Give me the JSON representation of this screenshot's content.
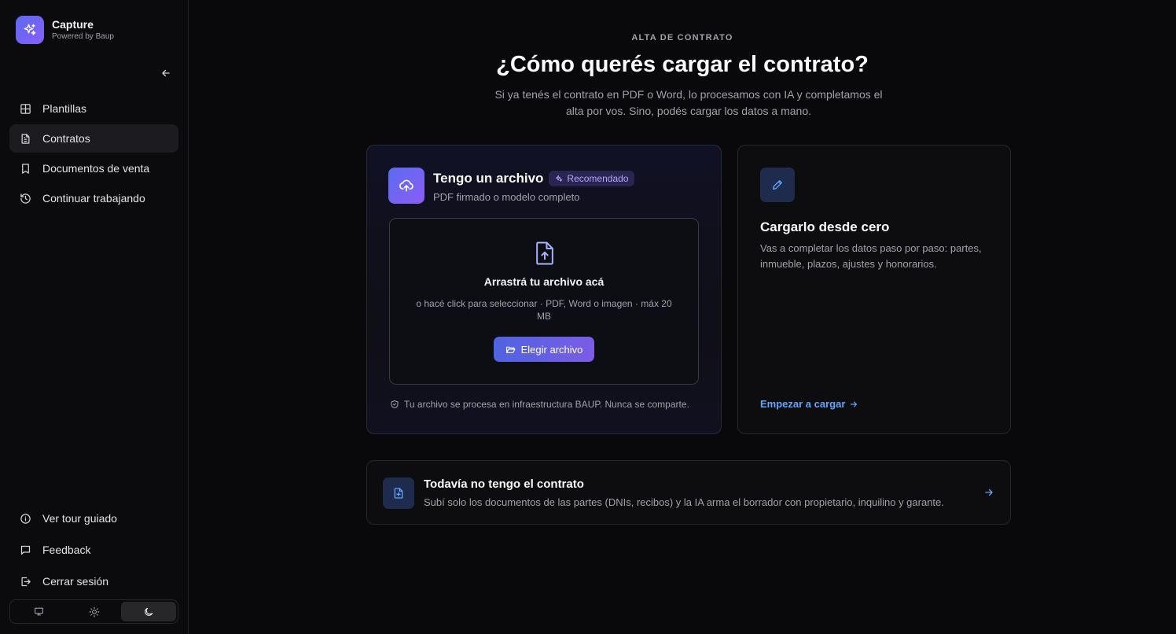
{
  "brand": {
    "name": "Capture",
    "tagline": "Powered by Baup"
  },
  "sidebar": {
    "items": [
      {
        "label": "Plantillas",
        "icon": "grid-icon",
        "active": false
      },
      {
        "label": "Contratos",
        "icon": "document-icon",
        "active": true
      },
      {
        "label": "Documentos de venta",
        "icon": "bookmark-icon",
        "active": false
      },
      {
        "label": "Continuar trabajando",
        "icon": "history-icon",
        "active": false
      }
    ],
    "bottom_items": [
      {
        "label": "Ver tour guiado",
        "icon": "info-icon"
      },
      {
        "label": "Feedback",
        "icon": "message-icon"
      },
      {
        "label": "Cerrar sesión",
        "icon": "logout-icon"
      }
    ],
    "theme_options": [
      "monitor-icon",
      "sun-icon",
      "moon-icon"
    ],
    "theme_active": "moon-icon"
  },
  "page": {
    "eyebrow": "ALTA DE CONTRATO",
    "title": "¿Cómo querés cargar el contrato?",
    "subtitle": "Si ya tenés el contrato en PDF o Word, lo procesamos con IA y completamos el alta por vos. Sino, podés cargar los datos a mano."
  },
  "upload_card": {
    "title": "Tengo un archivo",
    "badge": "Recomendado",
    "subtitle": "PDF firmado o modelo completo",
    "dropzone_title": "Arrastrá tu archivo acá",
    "dropzone_sub": "o hacé click para seleccionar · PDF, Word o imagen · máx 20 MB",
    "button": "Elegir archivo",
    "privacy": "Tu archivo se procesa en infraestructura BAUP. Nunca se comparte."
  },
  "manual_card": {
    "title": "Cargarlo desde cero",
    "description": "Vas a completar los datos paso por paso: partes, inmueble, plazos, ajustes y honorarios.",
    "link": "Empezar a cargar"
  },
  "no_contract_card": {
    "title": "Todavía no tengo el contrato",
    "description": "Subí solo los documentos de las partes (DNIs, recibos) y la IA arma el borrador con propietario, inquilino y garante."
  },
  "colors": {
    "accent_start": "#5b6cf0",
    "accent_end": "#8b5cf6",
    "link": "#60a5fa",
    "background": "#09090b"
  }
}
